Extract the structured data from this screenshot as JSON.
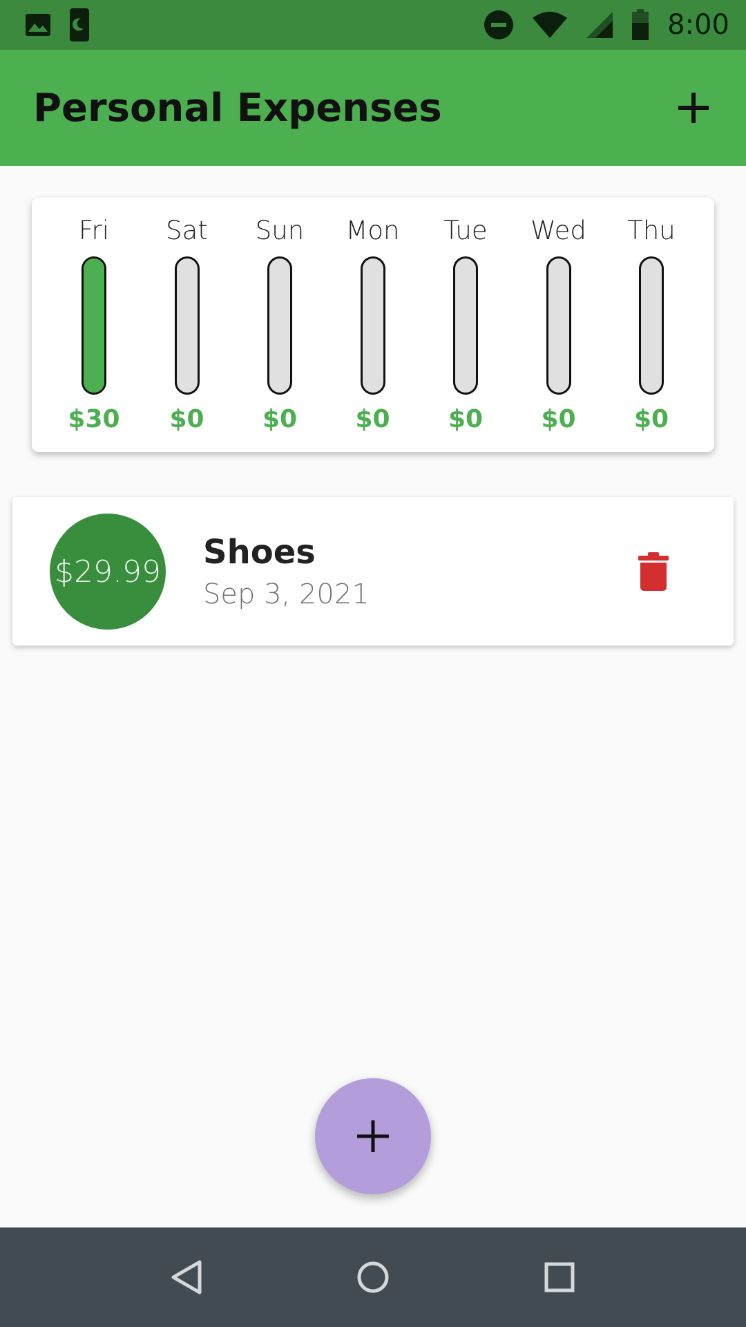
{
  "status_bar": {
    "time": "8:00",
    "icons": [
      "image-icon",
      "moon-phone-icon",
      "do-not-disturb-icon",
      "wifi-icon",
      "signal-icon",
      "battery-icon"
    ]
  },
  "app_bar": {
    "title": "Personal Expenses",
    "action_icon": "add-icon"
  },
  "chart": {
    "bars": [
      {
        "day": "Fri",
        "amount": "$30",
        "fill_fraction": 1.0
      },
      {
        "day": "Sat",
        "amount": "$0",
        "fill_fraction": 0
      },
      {
        "day": "Sun",
        "amount": "$0",
        "fill_fraction": 0
      },
      {
        "day": "Mon",
        "amount": "$0",
        "fill_fraction": 0
      },
      {
        "day": "Tue",
        "amount": "$0",
        "fill_fraction": 0
      },
      {
        "day": "Wed",
        "amount": "$0",
        "fill_fraction": 0
      },
      {
        "day": "Thu",
        "amount": "$0",
        "fill_fraction": 0
      }
    ],
    "colors": {
      "fill": "#4caf50",
      "track": "#e0e0e0",
      "amount_text": "#4caf50"
    }
  },
  "transactions": [
    {
      "amount": "$29.99",
      "title": "Shoes",
      "date": "Sep 3, 2021",
      "delete_icon": "trash-icon"
    }
  ],
  "fab": {
    "icon": "add-icon",
    "color": "#b39ddb"
  },
  "nav_bar": {
    "icons": [
      "back-icon",
      "home-icon",
      "recents-icon"
    ]
  },
  "colors": {
    "status_bar": "#3b8a3e",
    "app_bar": "#4caf50",
    "avatar": "#388e3c",
    "delete": "#d32f2f",
    "nav_bar": "#424a52"
  }
}
